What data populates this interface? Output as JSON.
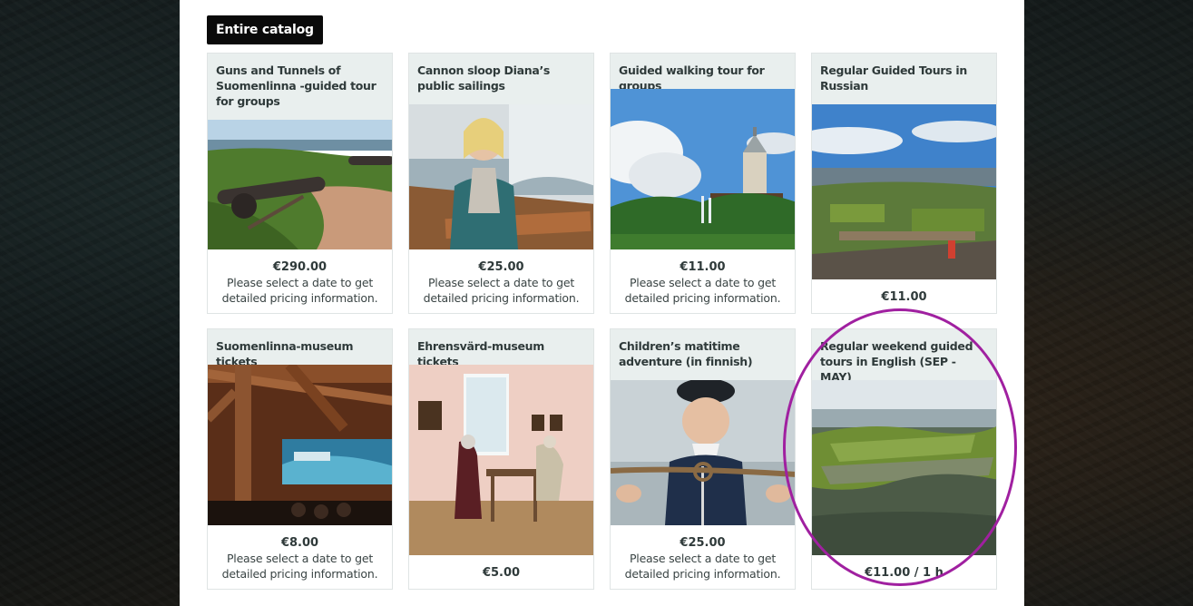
{
  "catalog_button_label": "Entire catalog",
  "products": [
    {
      "title": "Guns and Tunnels of Suomenlinna -guided tour for groups",
      "price": "€290.00",
      "info": "Please select a date to get detailed pricing information.",
      "image": "cannons-on-fortress-lawn"
    },
    {
      "title": "Cannon sloop Diana’s public sailings",
      "price": "€25.00",
      "info": "Please select a date to get detailed pricing information.",
      "image": "woman-on-sailboat"
    },
    {
      "title": "Guided walking tour for groups",
      "price": "€11.00",
      "info": "Please select a date to get detailed pricing information.",
      "image": "church-tower-and-trees"
    },
    {
      "title": "Regular Guided Tours in Russian",
      "price": "€11.00",
      "info": "",
      "image": "aerial-fortress-view"
    },
    {
      "title": "Suomenlinna-museum tickets",
      "price": "€8.00",
      "info": "Please select a date to get detailed pricing information.",
      "image": "museum-cinema-hall"
    },
    {
      "title": "Ehrensvärd-museum tickets",
      "price": "€5.00",
      "info": "",
      "image": "museum-period-room"
    },
    {
      "title": "Children’s matitime adventure (in finnish)",
      "price": "€25.00",
      "info": "Please select a date to get detailed pricing information.",
      "image": "sailor-with-rope"
    },
    {
      "title": "Regular weekend guided tours in English (SEP - MAY)",
      "price": "€11.00 / 1 h",
      "info": "",
      "image": "aerial-fortress-island"
    }
  ],
  "colors": {
    "highlight_ring": "#a020a0",
    "title_background": "#e9efee",
    "button_background": "#0a0a0a"
  }
}
